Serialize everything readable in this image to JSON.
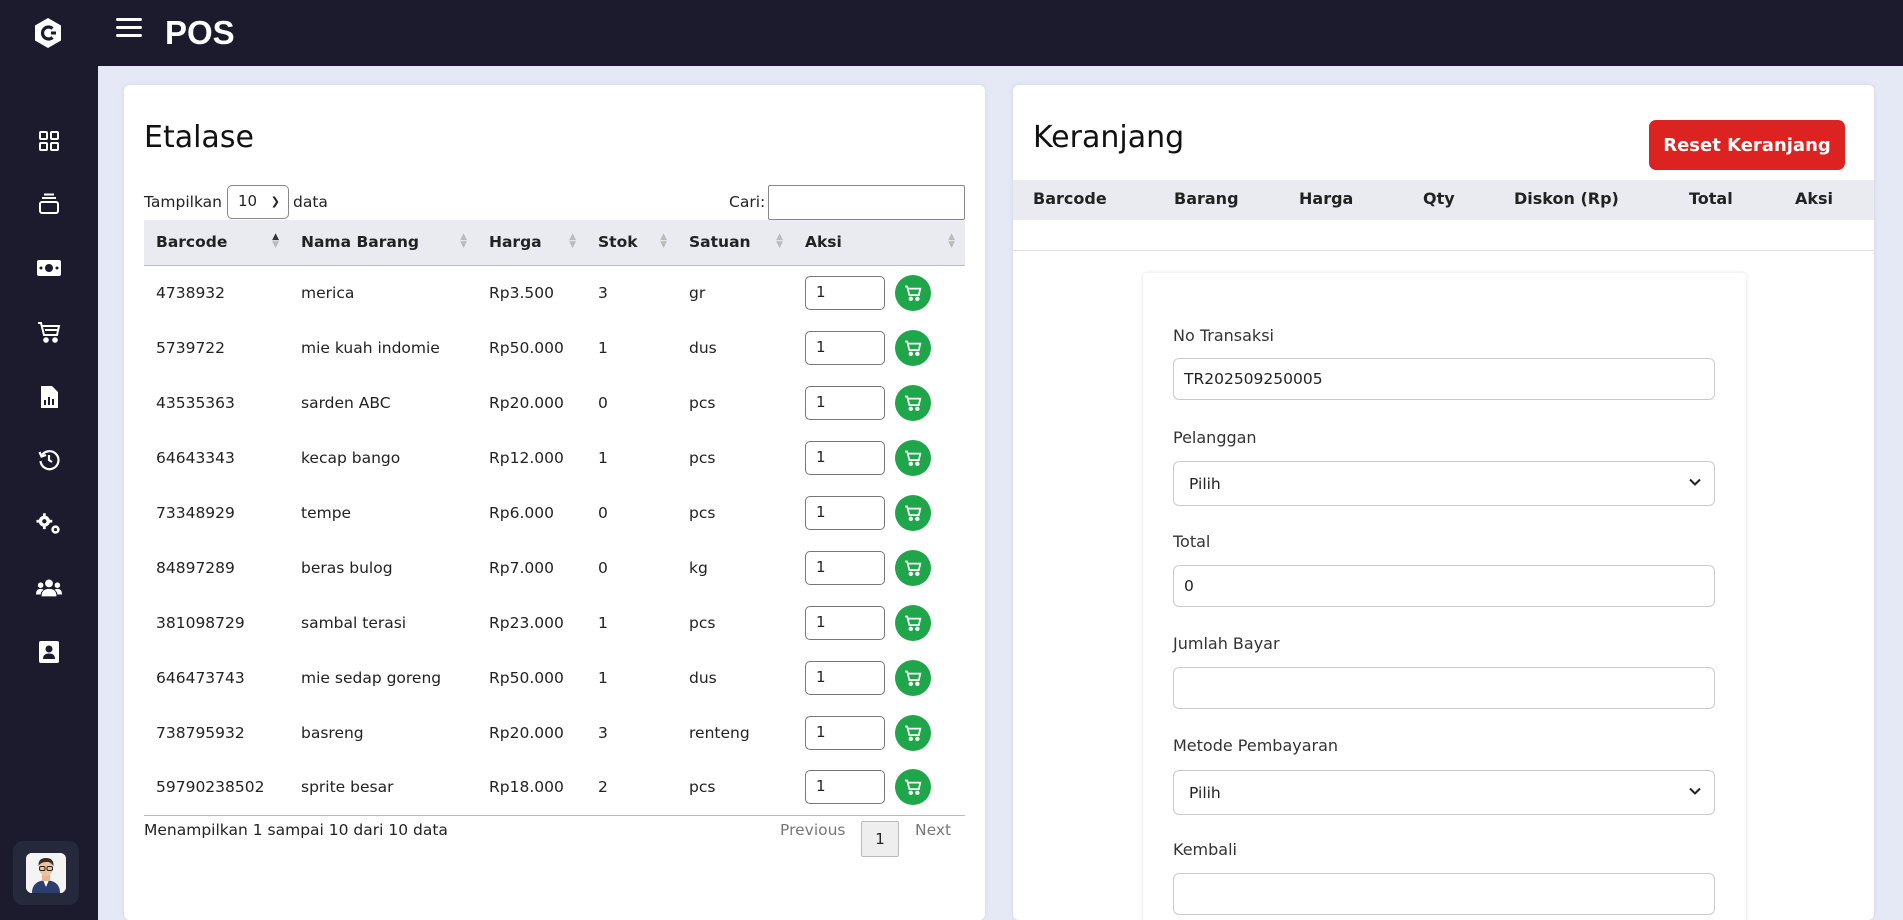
{
  "app": {
    "title": "POS"
  },
  "sidebar": {
    "items": [
      {
        "icon": "dashboard-icon"
      },
      {
        "icon": "layers-icon"
      },
      {
        "icon": "cash-icon"
      },
      {
        "icon": "cart-icon"
      },
      {
        "icon": "report-icon"
      },
      {
        "icon": "history-icon"
      },
      {
        "icon": "settings-icon"
      },
      {
        "icon": "users-icon"
      },
      {
        "icon": "profile-icon"
      }
    ]
  },
  "etalase": {
    "title": "Etalase",
    "show_prefix": "Tampilkan",
    "show_value": "10",
    "show_suffix": "data",
    "search_label": "Cari:",
    "search_value": "",
    "columns": [
      "Barcode",
      "Nama Barang",
      "Harga",
      "Stok",
      "Satuan",
      "Aksi"
    ],
    "rows": [
      {
        "barcode": "4738932",
        "name": "merica",
        "price": "Rp3.500",
        "stock": "3",
        "unit": "gr",
        "qty": "1"
      },
      {
        "barcode": "5739722",
        "name": "mie kuah indomie",
        "price": "Rp50.000",
        "stock": "1",
        "unit": "dus",
        "qty": "1"
      },
      {
        "barcode": "43535363",
        "name": "sarden ABC",
        "price": "Rp20.000",
        "stock": "0",
        "unit": "pcs",
        "qty": "1"
      },
      {
        "barcode": "64643343",
        "name": "kecap bango",
        "price": "Rp12.000",
        "stock": "1",
        "unit": "pcs",
        "qty": "1"
      },
      {
        "barcode": "73348929",
        "name": "tempe",
        "price": "Rp6.000",
        "stock": "0",
        "unit": "pcs",
        "qty": "1"
      },
      {
        "barcode": "84897289",
        "name": "beras bulog",
        "price": "Rp7.000",
        "stock": "0",
        "unit": "kg",
        "qty": "1"
      },
      {
        "barcode": "381098729",
        "name": "sambal terasi",
        "price": "Rp23.000",
        "stock": "1",
        "unit": "pcs",
        "qty": "1"
      },
      {
        "barcode": "646473743",
        "name": "mie sedap goreng",
        "price": "Rp50.000",
        "stock": "1",
        "unit": "dus",
        "qty": "1"
      },
      {
        "barcode": "738795932",
        "name": "basreng",
        "price": "Rp20.000",
        "stock": "3",
        "unit": "renteng",
        "qty": "1"
      },
      {
        "barcode": "59790238502",
        "name": "sprite besar",
        "price": "Rp18.000",
        "stock": "2",
        "unit": "pcs",
        "qty": "1"
      }
    ],
    "info": "Menampilkan 1 sampai 10 dari 10 data",
    "prev_label": "Previous",
    "page": "1",
    "next_label": "Next"
  },
  "keranjang": {
    "title": "Keranjang",
    "reset_label": "Reset Keranjang",
    "columns": [
      "Barcode",
      "Barang",
      "Harga",
      "Qty",
      "Diskon (Rp)",
      "Total",
      "Aksi"
    ],
    "form": {
      "no_transaksi_label": "No Transaksi",
      "no_transaksi_value": "TR202509250005",
      "pelanggan_label": "Pelanggan",
      "pelanggan_value": "Pilih",
      "total_label": "Total",
      "total_value": "0",
      "jumlah_bayar_label": "Jumlah Bayar",
      "jumlah_bayar_value": "",
      "metode_label": "Metode Pembayaran",
      "metode_value": "Pilih",
      "kembali_label": "Kembali",
      "kembali_value": ""
    }
  },
  "colors": {
    "sidebar_bg": "#1b1b2d",
    "page_bg": "#e4e9f5",
    "accent_green": "#20a64a",
    "danger_red": "#dd2222"
  }
}
